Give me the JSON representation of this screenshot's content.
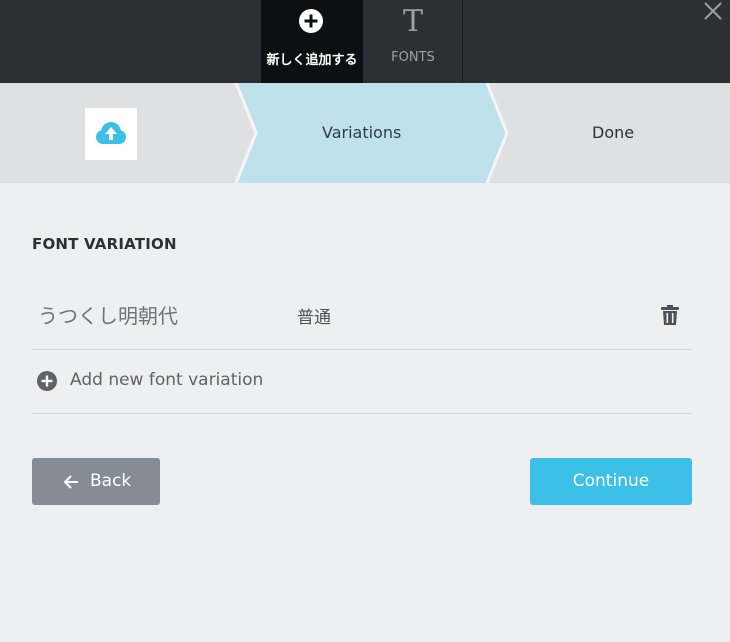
{
  "topbar": {
    "tabs": [
      {
        "label": "新しく追加する",
        "icon": "plus-circle-icon",
        "active": true
      },
      {
        "label": "FONTS",
        "icon": "font-t-icon",
        "icon_glyph": "T",
        "active": false
      }
    ],
    "close_icon": "close-icon"
  },
  "stepper": {
    "steps": [
      {
        "label": "",
        "icon": "cloud-upload-icon",
        "state": "completed"
      },
      {
        "label": "Variations",
        "state": "active"
      },
      {
        "label": "Done",
        "state": "pending"
      }
    ]
  },
  "content": {
    "section_title": "FONT VARIATION",
    "variations": [
      {
        "font_name": "うつくし明朝代",
        "style": "普通",
        "delete_icon": "trash-icon"
      }
    ],
    "add_variation_label": "Add new font variation"
  },
  "actions": {
    "back_label": "Back",
    "continue_label": "Continue"
  },
  "colors": {
    "accent": "#3dc0e8",
    "active_step": "#bfe1ec",
    "topbar": "#2c3036",
    "back_button": "#868c93"
  }
}
